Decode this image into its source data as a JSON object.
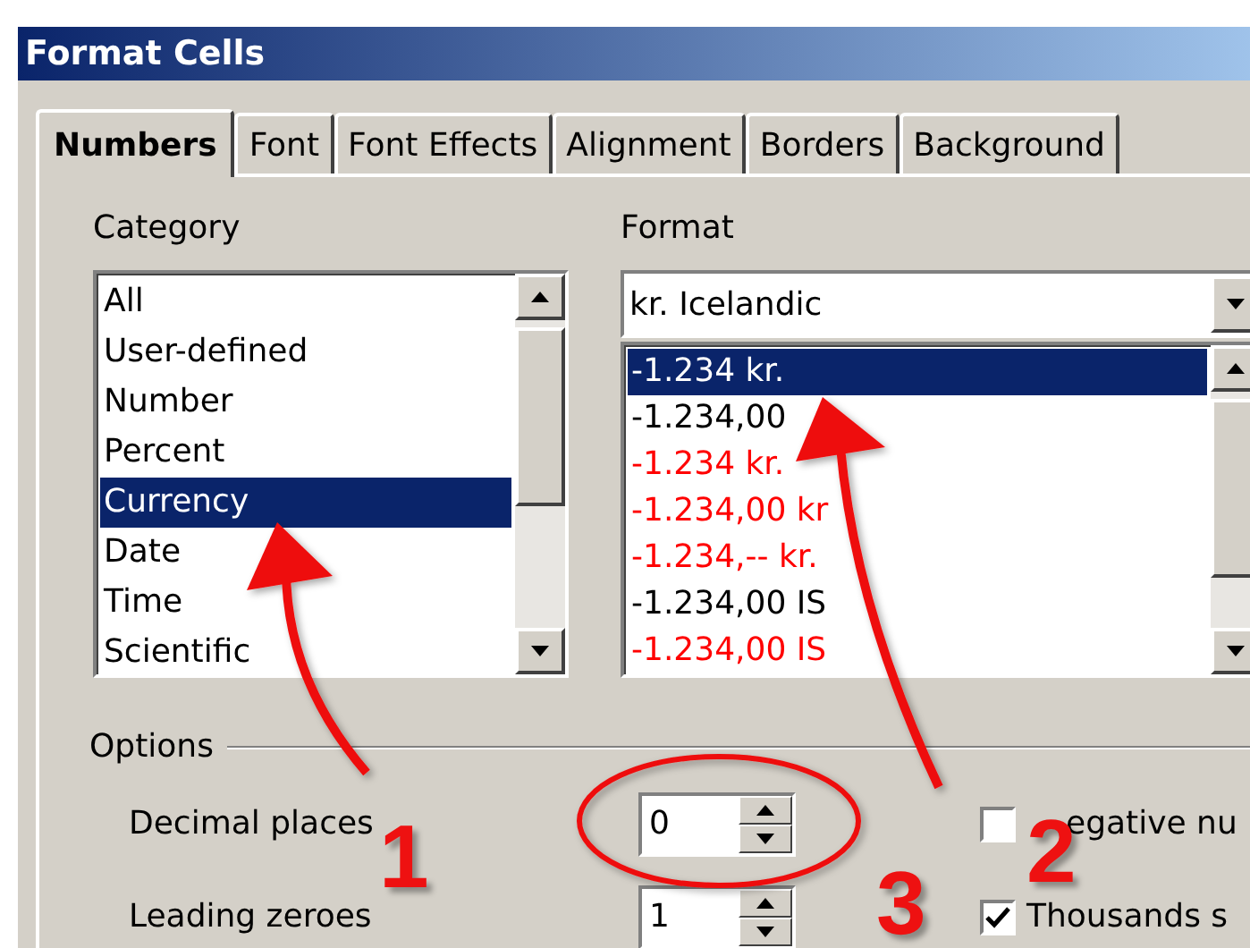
{
  "window": {
    "title": "Format Cells"
  },
  "tabs": [
    {
      "label": "Numbers",
      "selected": true
    },
    {
      "label": "Font",
      "selected": false
    },
    {
      "label": "Font Effects",
      "selected": false
    },
    {
      "label": "Alignment",
      "selected": false
    },
    {
      "label": "Borders",
      "selected": false
    },
    {
      "label": "Background",
      "selected": false
    }
  ],
  "category": {
    "label": "Category",
    "items": [
      {
        "label": "All",
        "selected": false
      },
      {
        "label": "User-defined",
        "selected": false
      },
      {
        "label": "Number",
        "selected": false
      },
      {
        "label": "Percent",
        "selected": false
      },
      {
        "label": "Currency",
        "selected": true
      },
      {
        "label": "Date",
        "selected": false
      },
      {
        "label": "Time",
        "selected": false
      },
      {
        "label": "Scientific",
        "selected": false
      }
    ]
  },
  "format": {
    "label": "Format",
    "value": "kr. Icelandic",
    "items": [
      {
        "label": "-1.234 kr.",
        "selected": true
      },
      {
        "label": "-1.234,00",
        "selected": false,
        "color": "#000000"
      },
      {
        "label": "-1.234 kr.",
        "selected": false,
        "color": "#ff0000"
      },
      {
        "label": "-1.234,00 kr",
        "selected": false,
        "color": "#ff0000"
      },
      {
        "label": "-1.234,-- kr.",
        "selected": false,
        "color": "#ff0000"
      },
      {
        "label": "-1.234,00 IS",
        "selected": false,
        "color": "#000000"
      },
      {
        "label": "-1.234,00 IS",
        "selected": false,
        "color": "#ff0000"
      }
    ]
  },
  "options": {
    "label": "Options",
    "fields": [
      {
        "label": "Decimal places",
        "value": "0"
      },
      {
        "label": "Leading zeroes",
        "value": "1"
      }
    ],
    "checks": [
      {
        "label": "egative nu",
        "checked": false
      },
      {
        "label": "Thousands s",
        "checked": true
      }
    ]
  },
  "annotations": [
    {
      "label": "1"
    },
    {
      "label": "2"
    },
    {
      "label": "3"
    }
  ]
}
